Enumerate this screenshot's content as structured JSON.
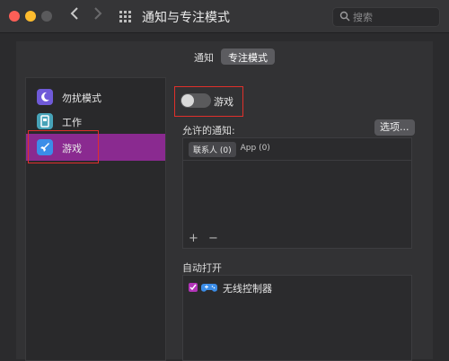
{
  "titlebar": {
    "back_icon": "chevron-left-icon",
    "forward_icon": "chevron-right-icon",
    "grid_icon": "grid-icon",
    "title": "通知与专注模式",
    "search_placeholder": "搜索"
  },
  "tabs": [
    {
      "label": "通知"
    },
    {
      "label": "专注模式",
      "active": true
    }
  ],
  "sidebar": {
    "items": [
      {
        "label": "勿扰模式",
        "icon": "moon-icon",
        "icon_color": "#6f5ad8"
      },
      {
        "label": "工作",
        "icon": "badge-icon",
        "icon_color": "#47a3b8"
      },
      {
        "label": "游戏",
        "icon": "rocket-icon",
        "icon_color": "#3b8de8",
        "selected": true
      }
    ]
  },
  "focus": {
    "toggle_label": "游戏",
    "toggle_on": false,
    "allowed_label": "允许的通知:",
    "options_button": "选项...",
    "notify_tabs": [
      "联系人 (0)",
      "App (0)"
    ],
    "add_label": "+",
    "remove_label": "−",
    "auto_label": "自动打开",
    "auto_items": [
      {
        "label": "无线控制器",
        "checked": true,
        "icon": "game-controller-icon"
      }
    ]
  },
  "colors": {
    "accent": "#8a2a90",
    "highlight_box": "#e0302b"
  }
}
